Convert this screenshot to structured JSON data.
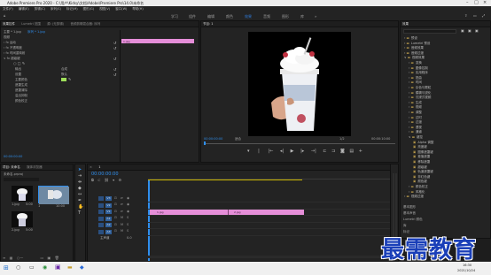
{
  "app": {
    "title": "Adobe Premiere Pro 2020 - C:\\用户\\Kidsy\\文档\\Adobe\\Premiere Pro\\14.0\\未命名"
  },
  "menu": [
    "文件(F)",
    "编辑(E)",
    "剪辑(C)",
    "序列(S)",
    "标记(M)",
    "图形(G)",
    "视图(V)",
    "窗口(W)",
    "帮助(H)"
  ],
  "workspaces": [
    "学习",
    "组件",
    "编辑",
    "颜色",
    "效果",
    "音频",
    "图形",
    "库",
    "»"
  ],
  "active_workspace": "效果",
  "effect_controls": {
    "tabs": [
      "效果控件",
      "Lumetri 范围",
      "源: (无剪辑)",
      "音频剪辑混合器: 序列"
    ],
    "clip_label": "主要 * 1.jpg",
    "seq_label": "序列 * 1.jpg",
    "section_video": "视频",
    "fx": [
      {
        "name": "运动"
      },
      {
        "name": "不透明度"
      },
      {
        "name": "时间重映射"
      },
      {
        "name": "超级键"
      }
    ],
    "props": [
      {
        "name": "输出",
        "value": "合成"
      },
      {
        "name": "设置",
        "value": "默认"
      },
      {
        "name": "主要颜色",
        "value": ""
      },
      {
        "name": "遮罩生成",
        "value": ""
      },
      {
        "name": "遮罩清除",
        "value": ""
      },
      {
        "name": "溢出抑制",
        "value": ""
      },
      {
        "name": "颜色校正",
        "value": ""
      }
    ],
    "clip_bar": "1.jpg",
    "timecode": "00:00:00:00"
  },
  "program": {
    "tab": "节目: 1",
    "timecode_left": "00:00:00:00",
    "fit": "适合",
    "ratio": "1/2",
    "timecode_right": "00:00:10:00"
  },
  "effects_panel": {
    "tab": "效果",
    "folders": [
      "预设",
      "Lumetri 预设",
      "音频效果",
      "音频过渡",
      "视频效果",
      "变换",
      "图像控制",
      "实用程序",
      "扭曲",
      "时间",
      "杂色与颗粒",
      "模糊与锐化",
      "沉浸式视频",
      "生成",
      "视频",
      "调整",
      "过时",
      "过渡",
      "透视",
      "通道",
      "键控"
    ],
    "keying_items": [
      "Alpha 调整",
      "亮度键",
      "图像遮罩键",
      "差值遮罩",
      "移除遮罩",
      "超级键",
      "轨道遮罩键",
      "非红色键",
      "颜色键"
    ],
    "folders_after": [
      "颜色校正",
      "风格化",
      "视频过渡"
    ],
    "bottom_tabs": [
      "基本图形",
      "基本声音",
      "Lumetri 颜色",
      "库",
      "标记"
    ]
  },
  "project": {
    "tabs": [
      "项目: 未命名",
      "媒体浏览器"
    ],
    "name": "未命名.prproj",
    "items": [
      {
        "label": "1.jpg",
        "dur": "5:00"
      },
      {
        "label": "1",
        "dur": "10:00"
      },
      {
        "label": "2.jpg",
        "dur": "5:00"
      }
    ]
  },
  "timeline": {
    "tab": "1",
    "timecode": "00:00:00:00",
    "tracks_video": [
      "V3",
      "V2",
      "V1"
    ],
    "tracks_audio": [
      "A1",
      "A2",
      "A3"
    ],
    "master": "主声道",
    "master_val": "0.0",
    "clip1": "1.jpg",
    "clip2": "2.jpg"
  },
  "taskbar": {
    "time": "16:30",
    "date": "2021/10/24"
  },
  "watermark": "最需教育"
}
